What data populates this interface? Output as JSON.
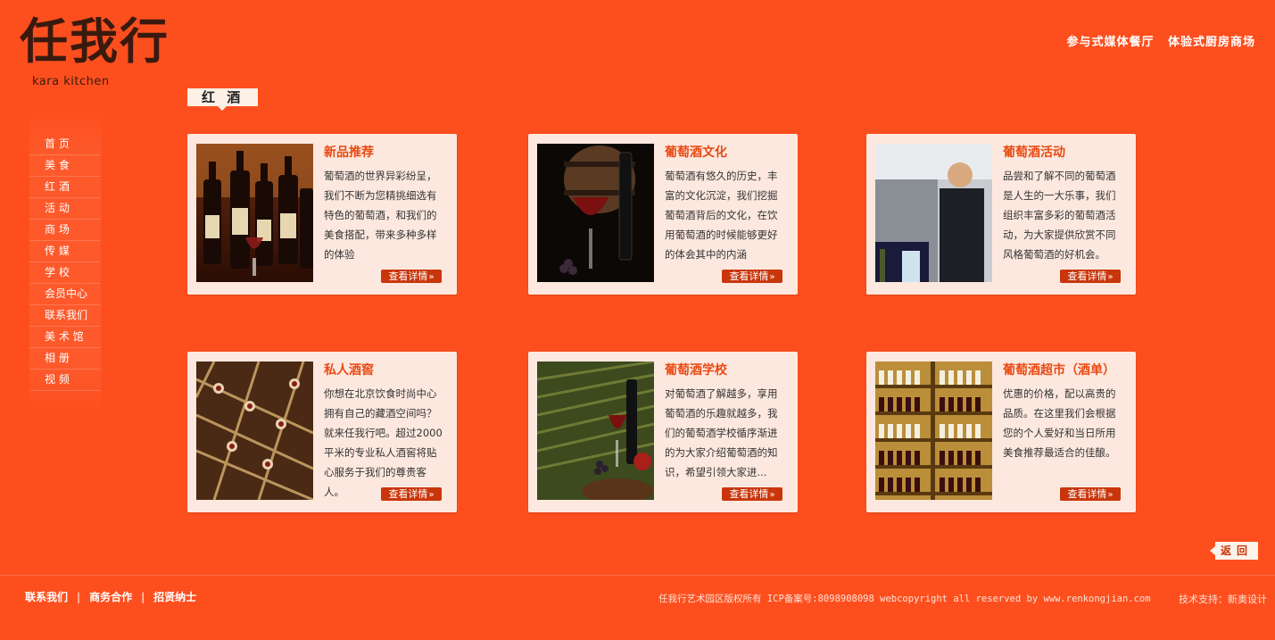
{
  "header": {
    "logo_text": "任我行",
    "logo_subtitle": "kara kitchen",
    "tagline_1": "参与式媒体餐厅",
    "tagline_2": "体验式厨房商场"
  },
  "section": {
    "title": "红 酒"
  },
  "nav": {
    "items": [
      {
        "label": "首    页"
      },
      {
        "label": "美    食"
      },
      {
        "label": "红    酒"
      },
      {
        "label": "活    动"
      },
      {
        "label": "商    场"
      },
      {
        "label": "传    媒"
      },
      {
        "label": "学    校"
      },
      {
        "label": "会员中心"
      },
      {
        "label": "联系我们"
      },
      {
        "label": "美 术 馆"
      },
      {
        "label": "相    册"
      },
      {
        "label": "视    频"
      }
    ]
  },
  "cards": [
    {
      "title": "新品推荐",
      "text": "葡萄酒的世界异彩纷呈，我们不断为您精挑细选有特色的葡萄酒，和我们的美食搭配，带来多种多样的体验",
      "button": "查看详情",
      "image_icon": "wine-bottles-image"
    },
    {
      "title": "葡萄酒文化",
      "text": "葡萄酒有悠久的历史，丰富的文化沉淀，我们挖掘葡萄酒背后的文化，在饮用葡萄酒的时候能够更好的体会其中的内涵",
      "button": "查看详情",
      "image_icon": "wine-barrel-image"
    },
    {
      "title": "葡萄酒活动",
      "text": "品尝和了解不同的葡萄酒是人生的一大乐事，我们组织丰富多彩的葡萄酒活动，为大家提供欣赏不同风格葡萄酒的好机会。",
      "button": "查看详情",
      "image_icon": "wine-event-image"
    },
    {
      "title": "私人酒窖",
      "text": "你想在北京饮食时尚中心拥有自己的藏酒空间吗？就来任我行吧。超过2000平米的专业私人酒窖将贴心服务于我们的尊贵客人。",
      "button": "查看详情",
      "image_icon": "wine-cellar-image"
    },
    {
      "title": "葡萄酒学校",
      "text": "对葡萄酒了解越多，享用葡萄酒的乐趣就越多，我们的葡萄酒学校循序渐进的为大家介绍葡萄酒的知识，希望引领大家进...",
      "button": "查看详情",
      "image_icon": "vineyard-image"
    },
    {
      "title": "葡萄酒超市（酒单）",
      "text": "优惠的价格，配以高贵的品质。在这里我们会根据您的个人爱好和当日所用美食推荐最适合的佳酿。",
      "button": "查看详情",
      "image_icon": "wine-shelf-image"
    }
  ],
  "back_button": "返回",
  "footer": {
    "links": [
      "联系我们",
      "商务合作",
      "招贤纳士"
    ],
    "separator": "|",
    "copyright": "任我行艺术园区版权所有 ICP备案号:8098908098 webcopyright all reserved by www.renkongjian.com",
    "tech_support": "技术支持：新奥设计"
  },
  "colors": {
    "background": "#fd4f1e",
    "card_background": "#fde8df",
    "card_title": "#e84a13",
    "button": "#c9360b"
  }
}
